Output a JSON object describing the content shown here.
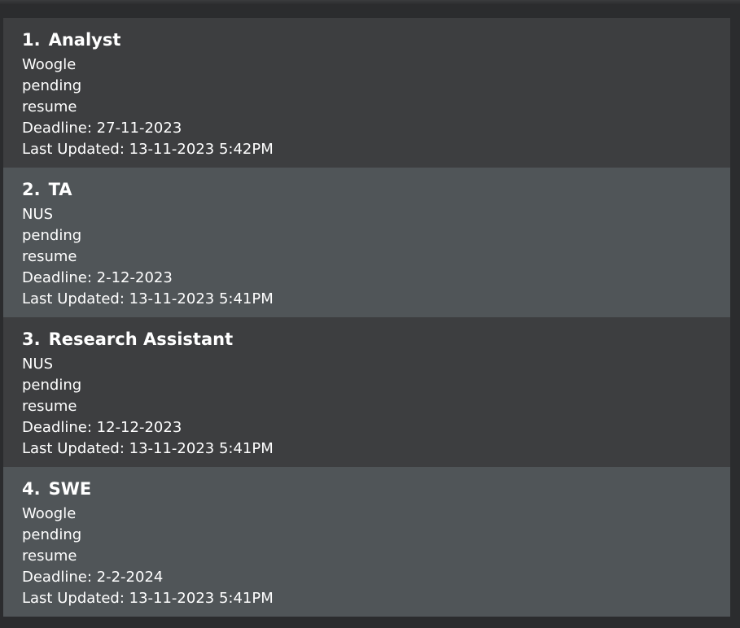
{
  "applications": [
    {
      "index": "1.",
      "role": "Analyst",
      "company": "Woogle",
      "status": "pending",
      "stage": "resume",
      "deadline": "Deadline: 27-11-2023",
      "last_updated": "Last Updated: 13-11-2023 5:42PM"
    },
    {
      "index": "2.",
      "role": "TA",
      "company": "NUS",
      "status": "pending",
      "stage": "resume",
      "deadline": "Deadline: 2-12-2023",
      "last_updated": "Last Updated: 13-11-2023 5:41PM"
    },
    {
      "index": "3.",
      "role": "Research Assistant",
      "company": "NUS",
      "status": "pending",
      "stage": "resume",
      "deadline": "Deadline: 12-12-2023",
      "last_updated": "Last Updated: 13-11-2023 5:41PM"
    },
    {
      "index": "4.",
      "role": "SWE",
      "company": "Woogle",
      "status": "pending",
      "stage": "resume",
      "deadline": "Deadline: 2-2-2024",
      "last_updated": "Last Updated: 13-11-2023 5:41PM"
    }
  ],
  "colors": {
    "background": "#2b2c2e",
    "card_dark": "#3d3e40",
    "card_light": "#505558",
    "text": "#ffffff"
  }
}
